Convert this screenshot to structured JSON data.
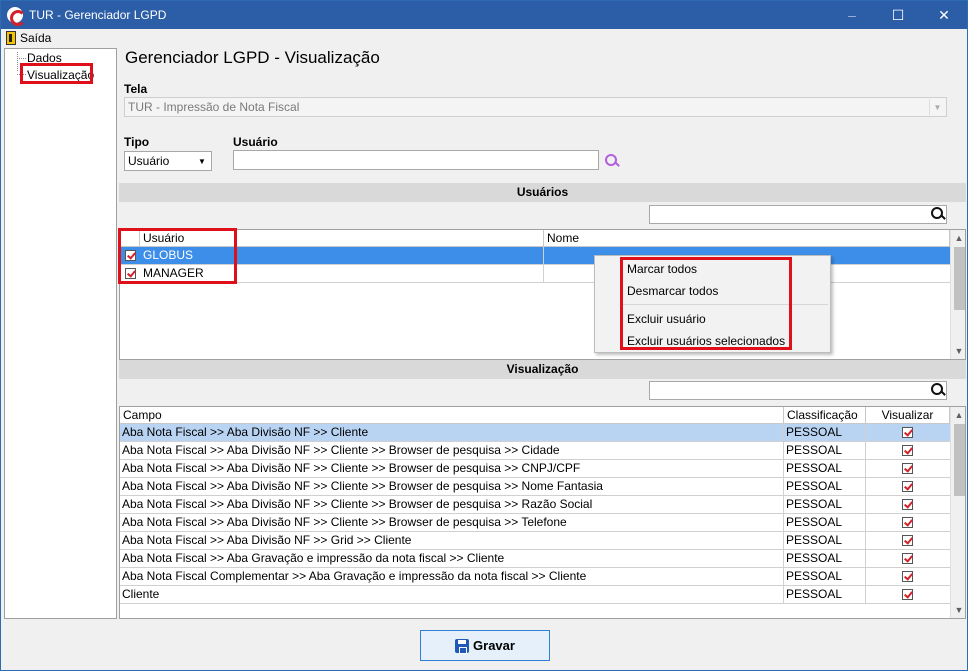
{
  "window": {
    "title": "TUR - Gerenciador LGPD",
    "controls": {
      "minimize": "–",
      "maximize": "☐",
      "close": "✕"
    }
  },
  "menu": {
    "exit_label": "Saída"
  },
  "tree": {
    "items": [
      {
        "label": "Dados"
      },
      {
        "label": "Visualização"
      }
    ]
  },
  "page": {
    "title": "Gerenciador LGPD - Visualização"
  },
  "tela": {
    "label": "Tela",
    "value": "TUR - Impressão de Nota Fiscal"
  },
  "tipo": {
    "label": "Tipo",
    "value": "Usuário"
  },
  "usuario_field": {
    "label": "Usuário",
    "value": ""
  },
  "users_section": {
    "header": "Usuários",
    "search_value": "",
    "columns": {
      "usuario": "Usuário",
      "nome": "Nome"
    },
    "rows": [
      {
        "usuario": "GLOBUS",
        "nome": "",
        "checked": true,
        "selected": true
      },
      {
        "usuario": "MANAGER",
        "nome": "",
        "checked": true,
        "selected": false
      }
    ]
  },
  "context_menu": {
    "items": [
      "Marcar todos",
      "Desmarcar todos",
      "Excluir usuário",
      "Excluir usuários selecionados"
    ]
  },
  "view_section": {
    "header": "Visualização",
    "search_value": "",
    "columns": {
      "campo": "Campo",
      "classificacao": "Classificação",
      "visualizar": "Visualizar"
    },
    "rows": [
      {
        "campo": "Aba Nota Fiscal >> Aba Divisão NF >> Cliente",
        "classificacao": "PESSOAL",
        "visualizar": true
      },
      {
        "campo": "Aba Nota Fiscal >> Aba Divisão NF >> Cliente >> Browser de pesquisa >> Cidade",
        "classificacao": "PESSOAL",
        "visualizar": true
      },
      {
        "campo": "Aba Nota Fiscal >> Aba Divisão NF >> Cliente >> Browser de pesquisa >> CNPJ/CPF",
        "classificacao": "PESSOAL",
        "visualizar": true
      },
      {
        "campo": "Aba Nota Fiscal >> Aba Divisão NF >> Cliente >> Browser de pesquisa >> Nome Fantasia",
        "classificacao": "PESSOAL",
        "visualizar": true
      },
      {
        "campo": "Aba Nota Fiscal >> Aba Divisão NF >> Cliente >> Browser de pesquisa >> Razão Social",
        "classificacao": "PESSOAL",
        "visualizar": true
      },
      {
        "campo": "Aba Nota Fiscal >> Aba Divisão NF >> Cliente >> Browser de pesquisa >> Telefone",
        "classificacao": "PESSOAL",
        "visualizar": true
      },
      {
        "campo": "Aba Nota Fiscal >> Aba Divisão NF >> Grid >> Cliente",
        "classificacao": "PESSOAL",
        "visualizar": true
      },
      {
        "campo": "Aba Nota Fiscal >> Aba Gravação e impressão da nota fiscal >> Cliente",
        "classificacao": "PESSOAL",
        "visualizar": true
      },
      {
        "campo": "Aba Nota Fiscal Complementar >> Aba Gravação e impressão da nota fiscal >> Cliente",
        "classificacao": "PESSOAL",
        "visualizar": true
      },
      {
        "campo": "Cliente",
        "classificacao": "PESSOAL",
        "visualizar": true
      }
    ]
  },
  "save_button": {
    "label": "Gravar"
  },
  "colors": {
    "titlebar": "#2b5ea7",
    "selection": "#3d8ee8",
    "highlight_red": "#e0101b",
    "check_red": "#d3202a"
  }
}
